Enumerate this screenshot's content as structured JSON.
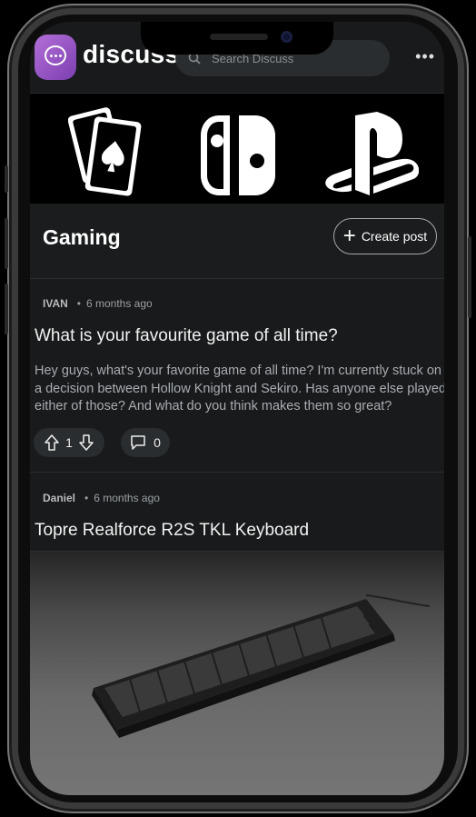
{
  "app": {
    "brand": "discuss"
  },
  "search": {
    "placeholder": "Search Discuss"
  },
  "menu": {
    "more": "•••"
  },
  "banner": {
    "icons": [
      "playing-cards-icon",
      "nintendo-switch-icon",
      "playstation-icon"
    ]
  },
  "community": {
    "title": "Gaming",
    "create_label": "Create post"
  },
  "posts": [
    {
      "author": "IVAN",
      "time": "6 months ago",
      "title": "What is your favourite game of all time?",
      "body": "Hey guys, what's your favorite game of all time? I'm currently stuck on a decision between Hollow Knight and Sekiro. Has anyone else played either of those? And what do you think makes them so great?",
      "votes": "1",
      "comments": "0"
    },
    {
      "author": "Daniel",
      "time": "6 months ago",
      "title": "Topre Realforce R2S TKL Keyboard",
      "image": "keyboard-photo"
    }
  ],
  "colors": {
    "accent": "#9b59d0",
    "background": "#181a1b"
  }
}
